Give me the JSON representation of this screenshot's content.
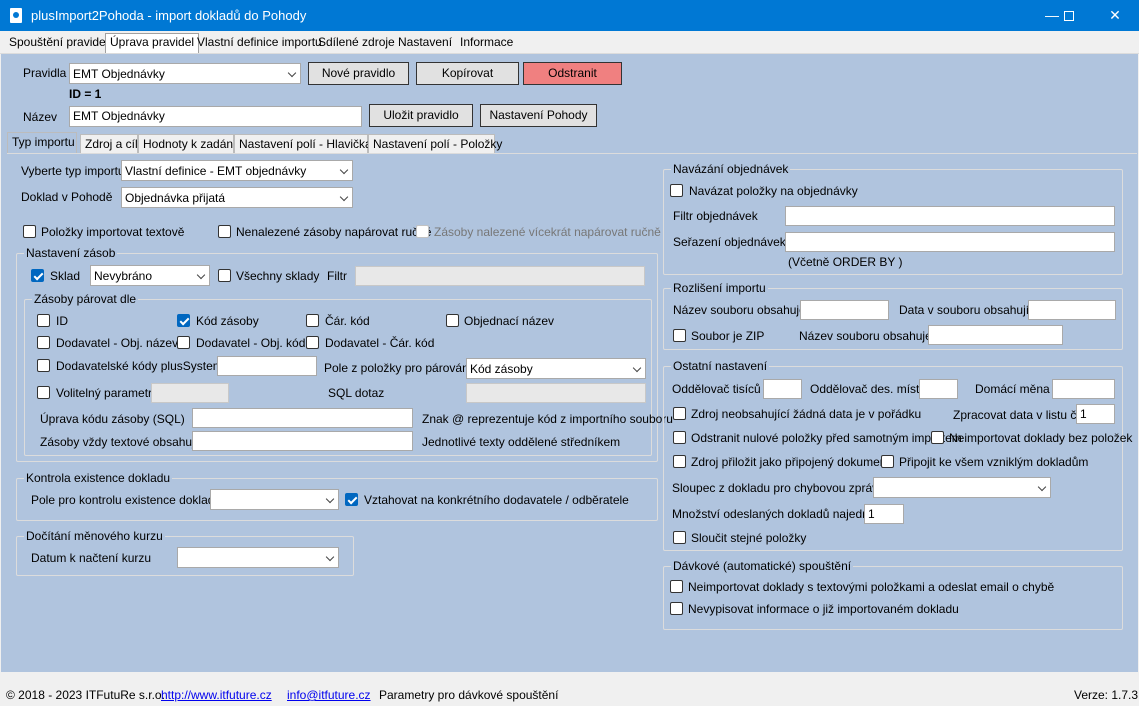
{
  "window": {
    "title": "plusImport2Pohoda - import dokladů do Pohody"
  },
  "menu": [
    "Spouštění pravidel",
    "Úprava pravidel",
    "Vlastní definice importu",
    "Sdílené zdroje",
    "Nastavení",
    "Informace"
  ],
  "rule": {
    "label": "Pravidla",
    "selected": "EMT Objednávky",
    "id_text": "ID = 1",
    "name_label": "Název",
    "name_value": "EMT Objednávky",
    "new_button": "Nové pravidlo",
    "copy_button": "Kopírovat",
    "delete_button": "Odstranit",
    "save_button": "Uložit pravidlo",
    "pohoda_button": "Nastavení Pohody",
    "delete_color": "#f08080"
  },
  "tabs": [
    "Typ importu",
    "Zdroj a cíl",
    "Hodnoty k zadání",
    "Nastavení polí - Hlavička",
    "Nastavení polí - Položky"
  ],
  "left": {
    "import_type_label": "Vyberte typ importu",
    "import_type_value": "Vlastní definice - EMT objednávky",
    "doc_label": "Doklad v Pohodě",
    "doc_value": "Objednávka přijatá",
    "items_text_label": "Položky importovat textově",
    "not_found_label": "Nenalezené zásoby napárovat ručně",
    "multi_found_label": "Zásoby nalezené vícekrát napárovat ručně",
    "stock_group": {
      "title": "Nastavení zásob",
      "sklad_label": "Sklad",
      "sklad_value": "Nevybráno",
      "all_label": "Všechny sklady",
      "filter_label": "Filtr",
      "pair_group": {
        "title": "Zásoby párovat dle",
        "id_label": "ID",
        "kod_label": "Kód zásoby",
        "car_label": "Čár. kód",
        "obj_label": "Objednací název",
        "dod_obj_label": "Dodavatel - Obj. název",
        "dod_kod_label": "Dodavatel - Obj. kód",
        "dod_car_label": "Dodavatel - Čár. kód",
        "dod_plus_label": "Dodavatelské kódy plusSystem",
        "pole_label": "Pole z položky pro párování",
        "pole_value": "Kód zásoby",
        "vol_label": "Volitelný parametr",
        "sql_label": "SQL dotaz",
        "uprava_label": "Úprava kódu zásoby (SQL)",
        "uprava_note": "Znak @ reprezentuje kód z importního souboru",
        "texty_label": "Zásoby vždy textové obsahují",
        "texty_note": "Jednotlivé texty oddělené středníkem"
      }
    },
    "exist_group": {
      "title": "Kontrola existence dokladu",
      "field_label": "Pole pro kontrolu existence dokladu",
      "vztah_label": "Vztahovat na konkrétního dodavatele / odběratele"
    },
    "rate_group": {
      "title": "Dočítání měnového kurzu",
      "date_label": "Datum k načtení kurzu"
    }
  },
  "right": {
    "orders_group": {
      "title": "Navázání objednávek",
      "link_label": "Navázat položky na objednávky",
      "filter_label": "Filtr objednávek",
      "sort_label": "Seřazení objednávek",
      "note": "(Včetně ORDER BY )"
    },
    "diff_group": {
      "title": "Rozlišení importu",
      "file_contains_label": "Název souboru obsahuje",
      "data_contains_label": "Data v souboru obsahují",
      "zip_label": "Soubor je ZIP",
      "zip_name_label": "Název souboru obsahuje"
    },
    "other_group": {
      "title": "Ostatní nastavení",
      "thousands_label": "Oddělovač tisíců",
      "decimal_label": "Oddělovač des. míst",
      "currency_label": "Domácí měna",
      "empty_ok_label": "Zdroj neobsahující žádná data je v pořádku",
      "process_label": "Zpracovat data v listu č.",
      "process_value": "1",
      "remove_zero_label": "Odstranit nulové položky před samotným importem",
      "no_items_label": "Neimportovat doklady bez položek",
      "attach_label": "Zdroj přiložit jako připojený dokument",
      "attach_all_label": "Připojit ke všem vzniklým dokladům",
      "error_col_label": "Sloupec z dokladu pro chybovou zprávu",
      "count_label": "Množství odeslaných dokladů najednou",
      "count_value": "1",
      "merge_label": "Sloučit stejné položky"
    },
    "batch_group": {
      "title": "Dávkové (automatické) spouštění",
      "no_text_label": "Neimportovat doklady s textovými položkami a odeslat email o chybě",
      "no_info_label": "Nevypisovat informace o již importovaném dokladu"
    }
  },
  "status": {
    "copyright": "© 2018 - 2023 ITFutuRe s.r.o.",
    "url": "http://www.itfuture.cz",
    "email": "info@itfuture.cz",
    "params": "Parametry pro dávkové spouštění",
    "version": "Verze: 1.7.3"
  },
  "colors": {
    "titlebar": "#0078d4",
    "panel": "#b0c4de",
    "checked": "#0067c0"
  },
  "icons": {
    "app": "document-icon",
    "minimize": "minimize-icon",
    "maximize": "maximize-icon",
    "close": "close-icon"
  }
}
